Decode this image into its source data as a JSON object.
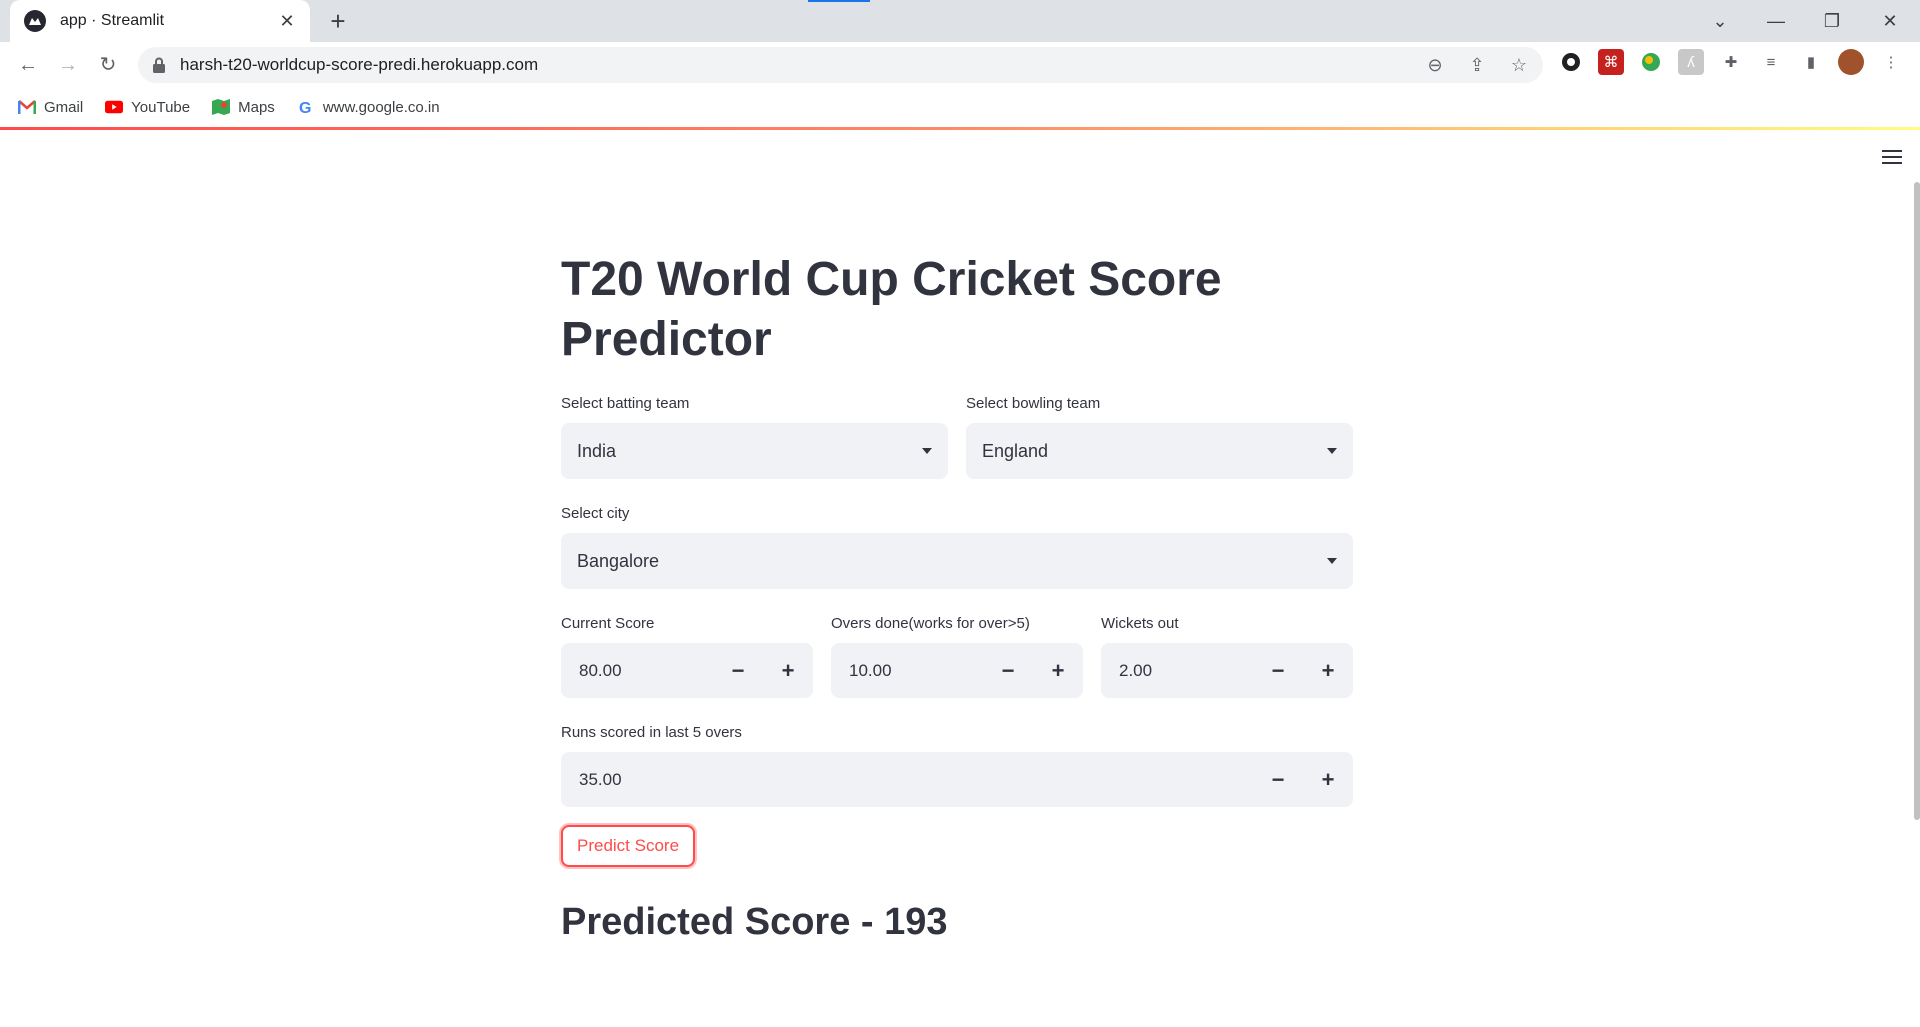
{
  "browser": {
    "tab_title": "app · Streamlit",
    "url": "harsh-t20-worldcup-score-predi.herokuapp.com",
    "bookmarks": [
      {
        "label": "Gmail",
        "icon": "gmail-icon"
      },
      {
        "label": "YouTube",
        "icon": "youtube-icon"
      },
      {
        "label": "Maps",
        "icon": "maps-icon"
      },
      {
        "label": "www.google.co.in",
        "icon": "google-icon"
      }
    ],
    "accent_colors": [
      "#ff4b4b",
      "#fffd80"
    ]
  },
  "app": {
    "title": "T20 World Cup Cricket Score Predictor",
    "batting_team": {
      "label": "Select batting team",
      "value": "India"
    },
    "bowling_team": {
      "label": "Select bowling team",
      "value": "England"
    },
    "city": {
      "label": "Select city",
      "value": "Bangalore"
    },
    "current_score": {
      "label": "Current Score",
      "value": "80.00"
    },
    "overs_done": {
      "label": "Overs done(works for over>5)",
      "value": "10.00"
    },
    "wickets_out": {
      "label": "Wickets out",
      "value": "2.00"
    },
    "last_five": {
      "label": "Runs scored in last 5 overs",
      "value": "35.00"
    },
    "predict_button": "Predict Score",
    "result": "Predicted Score - 193",
    "stepper_minus": "−",
    "stepper_plus": "+",
    "primary_color": "#ff4b4b"
  }
}
